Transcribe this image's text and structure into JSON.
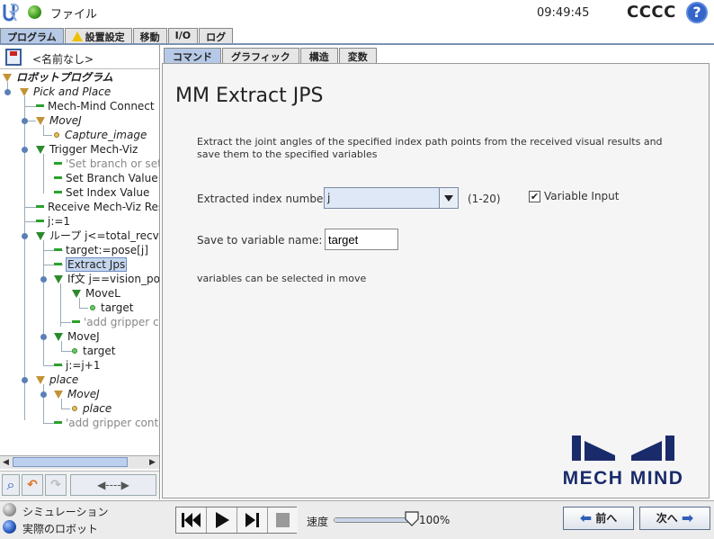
{
  "header": {
    "file_menu": "ファイル",
    "clock": "09:49:45",
    "robot_name": "CCCC",
    "help": "?"
  },
  "main_tabs": [
    {
      "label": "プログラム",
      "active": true
    },
    {
      "label": "設置設定",
      "warning": true
    },
    {
      "label": "移動"
    },
    {
      "label": "I/O"
    },
    {
      "label": "ログ"
    }
  ],
  "program": {
    "name": "<名前なし>"
  },
  "tree": {
    "root": "ロボットプログラム",
    "pick_and_place": "Pick and Place",
    "mm_connect": "Mech-Mind Connect",
    "movej_1": "MoveJ",
    "capture_image": "Capture_image",
    "trigger_viz": "Trigger Mech-Viz",
    "set_branch_comment": "'Set branch or set i",
    "set_branch_value": "Set Branch Value",
    "set_index_value": "Set Index Value",
    "receive_viz": "Receive Mech-Viz Res",
    "j_assign": "j:=1",
    "loop": "ループ j<=total_recv",
    "target_assign": "target:=pose[j]",
    "extract_jps": "Extract Jps",
    "if_stmt": "If文 j==vision_poi",
    "movel": "MoveL",
    "target_1": "target",
    "add_gripper_1": "'add gripper co",
    "movej_2": "MoveJ",
    "target_2": "target",
    "j_increment": "j:=j+1",
    "place": "place",
    "movej_3": "MoveJ",
    "place_wp": "place",
    "add_gripper_2": "'add gripper contro"
  },
  "sub_tabs": [
    {
      "label": "コマンド",
      "active": true
    },
    {
      "label": "グラフィック"
    },
    {
      "label": "構造"
    },
    {
      "label": "変数"
    }
  ],
  "command": {
    "title": "MM Extract JPS",
    "description": "Extract the joint angles of the specified index path points from the received visual results and save them to the specified variables",
    "index_label": "Extracted index number:",
    "index_value": "j",
    "index_range": "(1-20)",
    "variable_input_label": "Variable Input",
    "variable_input_checked": true,
    "save_label": "Save to variable name:",
    "save_value": "target",
    "note": "variables can be selected in move"
  },
  "brand": {
    "logo_text": "MECH MIND",
    "color": "#1a2b6b"
  },
  "bottom": {
    "simulation": "シミュレーション",
    "real_robot": "実際のロボット",
    "speed_label": "速度",
    "speed_value": "100%",
    "speed_fraction": 1.0,
    "prev": "前へ",
    "next": "次へ"
  }
}
